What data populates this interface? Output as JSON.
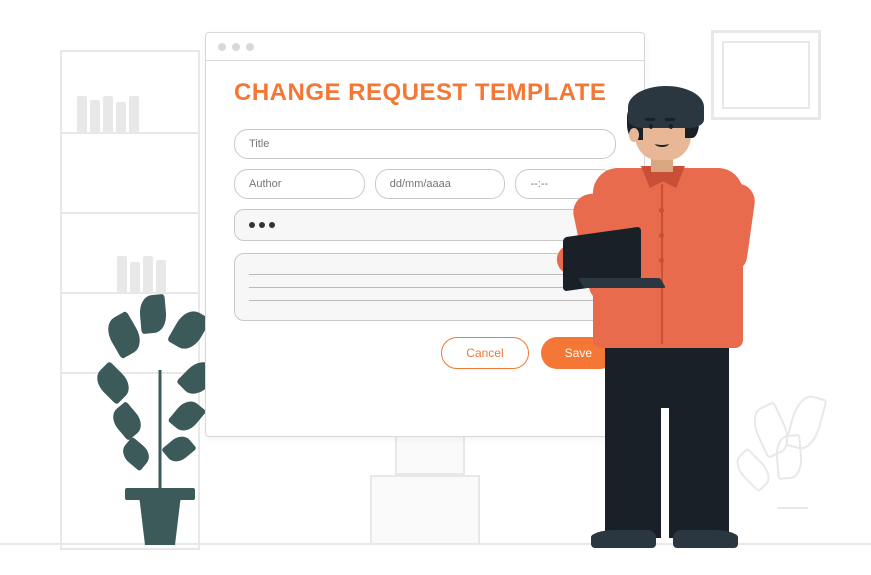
{
  "form": {
    "title": "CHANGE REQUEST TEMPLATE",
    "fields": {
      "title_placeholder": "Title",
      "author_placeholder": "Author",
      "date_placeholder": "dd/mm/aaaa",
      "time_placeholder": "--:--"
    },
    "buttons": {
      "cancel": "Cancel",
      "save": "Save"
    }
  },
  "colors": {
    "accent": "#f47735",
    "text_muted": "#999999",
    "border": "#c8c8c8"
  }
}
